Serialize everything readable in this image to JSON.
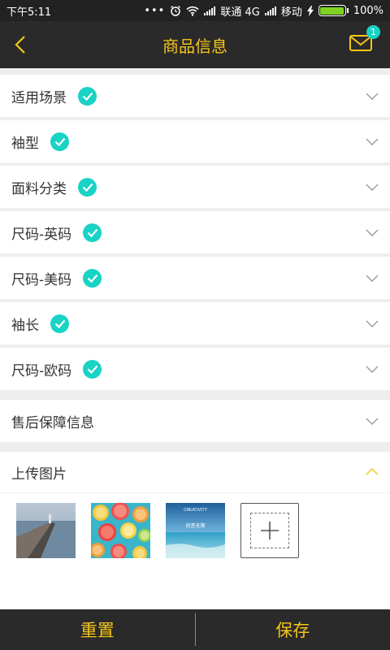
{
  "status_bar": {
    "time": "下午5:11",
    "carrier1": "联通 4G",
    "carrier2": "移动",
    "battery": "100%"
  },
  "header": {
    "title": "商品信息",
    "mail_badge": "1"
  },
  "rows": [
    {
      "label": "适用场景",
      "checked": true
    },
    {
      "label": "袖型",
      "checked": true
    },
    {
      "label": "面料分类",
      "checked": true
    },
    {
      "label": "尺码-英码",
      "checked": true
    },
    {
      "label": "尺码-美码",
      "checked": true
    },
    {
      "label": "袖长",
      "checked": true
    },
    {
      "label": "尺码-欧码",
      "checked": true
    },
    {
      "label": "售后保障信息",
      "checked": false
    }
  ],
  "upload": {
    "label": "上传图片",
    "thumb3_text_top": "CREATIVITY",
    "thumb3_text_mid": "创意无限"
  },
  "footer": {
    "reset_label": "重置",
    "save_label": "保存"
  },
  "colors": {
    "accent": "#f5c518",
    "check": "#19d3c5",
    "bar": "#2a2a2a"
  }
}
